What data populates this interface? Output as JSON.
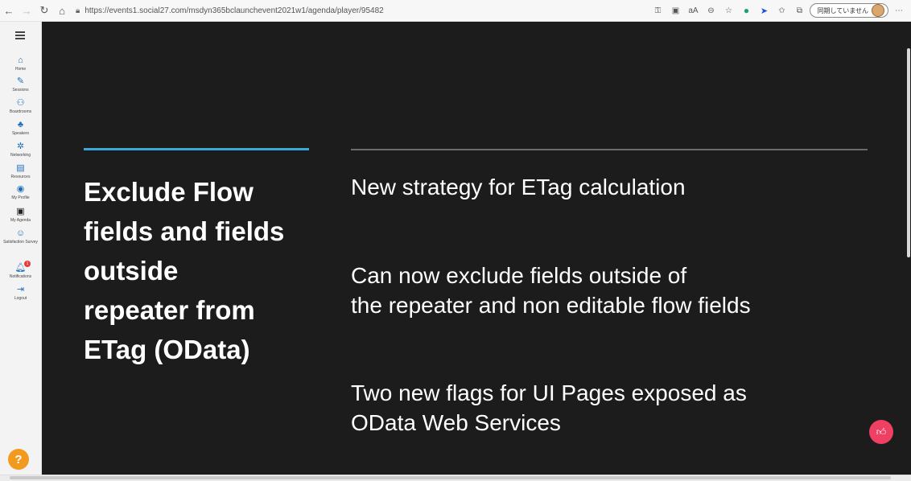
{
  "browser": {
    "url": "https://events1.social27.com/msdyn365bclaunchevent2021w1/agenda/player/95482",
    "sync_label": "同期していません"
  },
  "sidebar": {
    "items": [
      {
        "label": "Home",
        "icon": "home-icon"
      },
      {
        "label": "Sessions",
        "icon": "pencil-icon"
      },
      {
        "label": "Boardrooms",
        "icon": "boardroom-icon"
      },
      {
        "label": "Speakers",
        "icon": "speaker-icon"
      },
      {
        "label": "Networking",
        "icon": "networking-icon"
      },
      {
        "label": "Resources",
        "icon": "resources-icon"
      },
      {
        "label": "My Profile",
        "icon": "profile-icon"
      },
      {
        "label": "My Agenda",
        "icon": "calendar-icon"
      },
      {
        "label": "Satisfaction Survey",
        "icon": "survey-icon"
      },
      {
        "label": "Notifications",
        "icon": "bell-icon"
      },
      {
        "label": "Logout",
        "icon": "logout-icon"
      }
    ],
    "notification_count": "1"
  },
  "slide": {
    "title": "Exclude Flow\nfields and fields\noutside\nrepeater from\nETag (OData)",
    "points": [
      "New strategy for ETag calculation",
      "Can now exclude fields outside of\nthe repeater and non editable flow fields",
      "Two new flags for UI Pages exposed as\nOData Web Services"
    ]
  },
  "colors": {
    "slide_bg": "#1c1c1c",
    "accent": "#3da7db",
    "like_button": "#ef3f63",
    "help_button": "#f29a1d"
  }
}
